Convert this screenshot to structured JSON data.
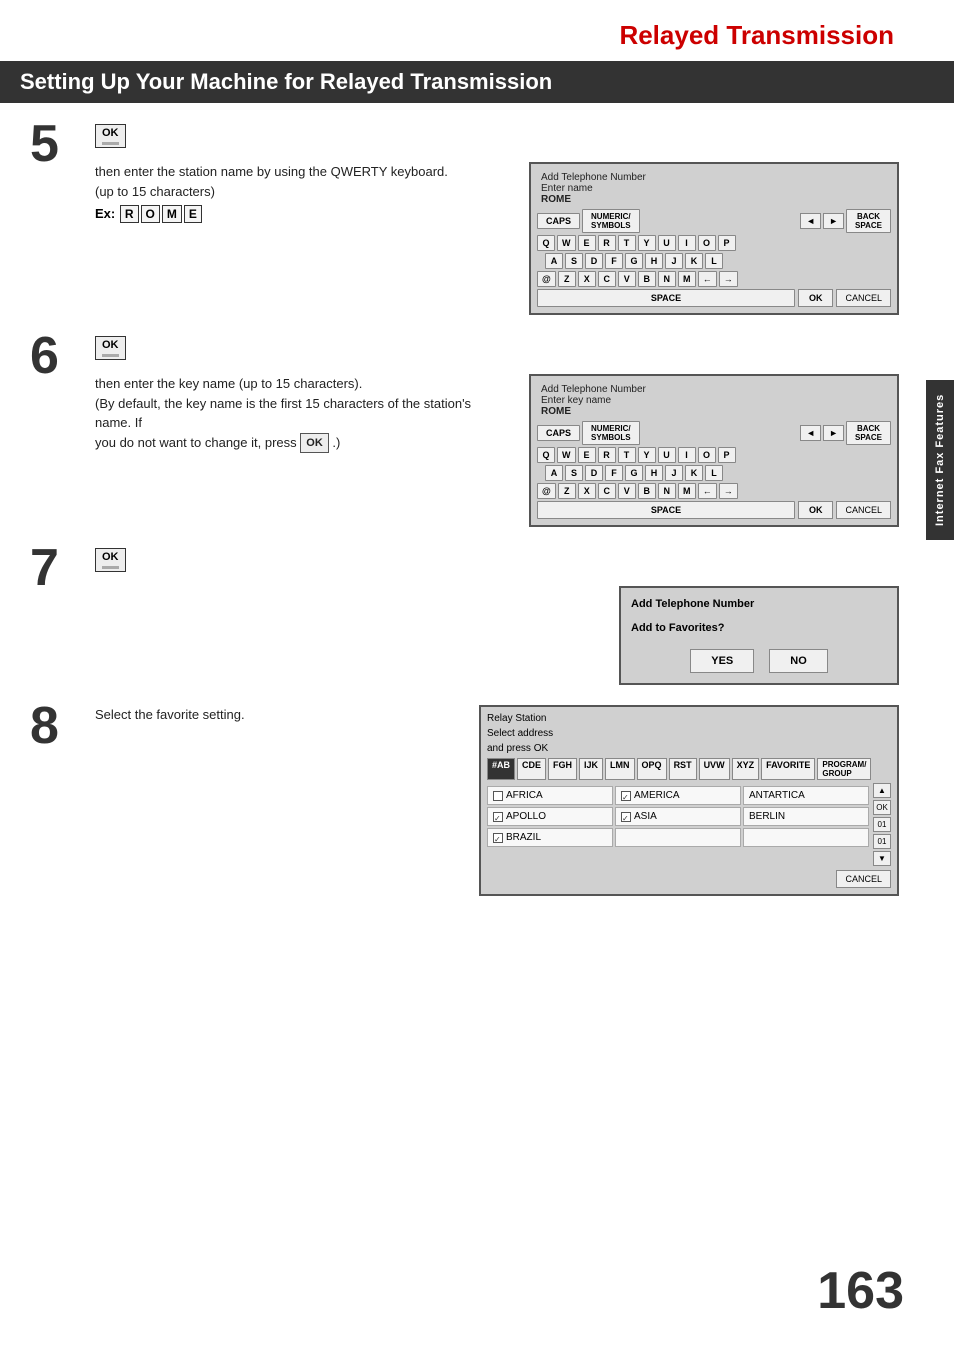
{
  "page": {
    "title": "Relayed Transmission",
    "section_heading": "Setting Up Your Machine for Relayed Transmission",
    "page_number": "163",
    "sidebar_label": "Internet Fax Features"
  },
  "steps": {
    "step5": {
      "number": "5",
      "ok_button": "OK",
      "instruction1": "then enter the station name by using the QWERTY keyboard.",
      "instruction2": "(up to 15 characters)",
      "ex_label": "Ex:",
      "ex_keys": [
        "R",
        "O",
        "M",
        "E"
      ],
      "keyboard": {
        "title": "Add Telephone Number",
        "subtitle": "Enter name",
        "name_shown": "ROME",
        "caps": "CAPS",
        "numeric": "NUMERIC/\nSYMBOLS",
        "backspace": "BACK\nSPACE",
        "row1": [
          "Q",
          "W",
          "E",
          "R",
          "T",
          "Y",
          "U",
          "I",
          "O",
          "P"
        ],
        "row2": [
          "A",
          "S",
          "D",
          "F",
          "G",
          "H",
          "J",
          "K",
          "L"
        ],
        "row3": [
          "@",
          "Z",
          "X",
          "C",
          "V",
          "B",
          "N",
          "M",
          "<",
          ">"
        ],
        "space": "SPACE",
        "ok": "OK",
        "cancel": "CANCEL"
      }
    },
    "step6": {
      "number": "6",
      "ok_button": "OK",
      "instruction1": "then enter the key name (up to 15 characters).",
      "instruction2": "(By default, the key name is the first 15 characters of the station's name.  If",
      "instruction3": "you do not want to change it, press",
      "ok_inline": "OK",
      "instruction4": ".)",
      "keyboard": {
        "title": "Add Telephone Number",
        "subtitle": "Enter key name",
        "name_shown": "ROME",
        "caps": "CAPS",
        "numeric": "NUMERIC/\nSYMBOLS",
        "backspace": "BACK\nSPACE",
        "row1": [
          "Q",
          "W",
          "E",
          "R",
          "T",
          "Y",
          "U",
          "I",
          "O",
          "P"
        ],
        "row2": [
          "A",
          "S",
          "D",
          "F",
          "G",
          "H",
          "J",
          "K",
          "L"
        ],
        "row3": [
          "@",
          "Z",
          "X",
          "C",
          "V",
          "B",
          "N",
          "M",
          "<",
          ">"
        ],
        "space": "SPACE",
        "ok": "OK",
        "cancel": "CANCEL"
      }
    },
    "step7": {
      "number": "7",
      "ok_button": "OK",
      "dialog": {
        "title": "Add Telephone Number",
        "question": "Add to Favorites?",
        "yes": "YES",
        "no": "NO"
      }
    },
    "step8": {
      "number": "8",
      "instruction": "Select the favorite setting.",
      "address_book": {
        "title": "Relay Station",
        "subtitle": "Select address",
        "subtitle2": "and press OK",
        "tabs": [
          "#AB",
          "CDE",
          "FGH",
          "IJK",
          "LMN",
          "OPQ",
          "RST",
          "UVW",
          "XYZ",
          "FAVORITE",
          "PROGRAM/\nGROUP"
        ],
        "entries": [
          {
            "name": "AFRICA",
            "checked": false
          },
          {
            "name": "AMERICA",
            "checked": true
          },
          {
            "name": "ANTARTICA",
            "checked": false
          },
          {
            "name": "APOLLO",
            "checked": true
          },
          {
            "name": "ASIA",
            "checked": true
          },
          {
            "name": "BERLIN",
            "checked": false
          },
          {
            "name": "BRAZIL",
            "checked": true
          },
          {
            "name": "",
            "checked": false
          },
          {
            "name": "",
            "checked": false
          }
        ],
        "ok": "OK",
        "cancel": "CANCEL"
      }
    }
  }
}
